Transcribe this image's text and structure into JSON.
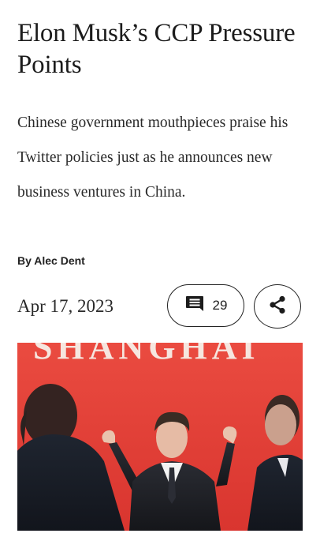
{
  "article": {
    "title": "Elon Musk’s CCP Pressure Points",
    "subtitle": "Chinese government mouthpieces praise his Twitter policies just as he announces new business ventures in China.",
    "byline": "By Alec Dent",
    "date": "Apr 17, 2023",
    "comment_count": "29"
  },
  "actions": {
    "comment_icon": "comment-icon",
    "share_icon": "share-icon"
  },
  "hero_image": {
    "sign_text": "SHANGHAI"
  },
  "colors": {
    "text": "#1b1b1b",
    "sign_red": "#e2423a"
  }
}
